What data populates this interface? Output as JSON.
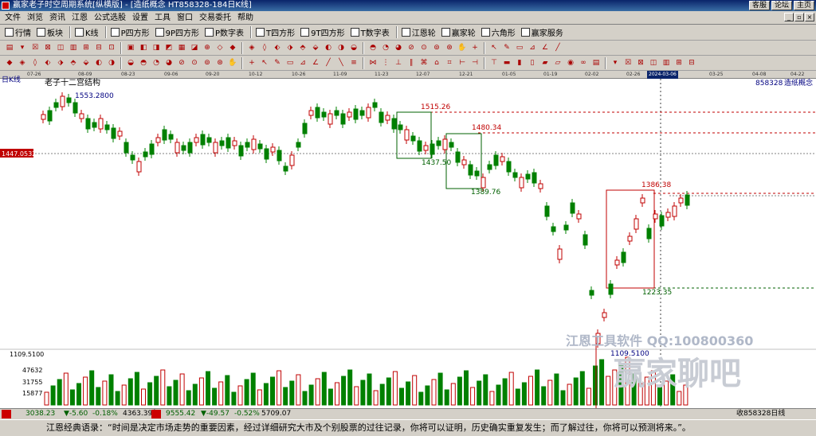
{
  "window": {
    "title": "赢家老子时空周期系统[纵横版] - [造纸概念  HT858328-184日K线]",
    "buttons": [
      "客服",
      "论坛",
      "主页"
    ]
  },
  "menu": [
    "文件",
    "浏览",
    "资讯",
    "江恩",
    "公式选股",
    "设置",
    "工具",
    "窗口",
    "交易委托",
    "帮助"
  ],
  "toolbar1": [
    "行情",
    "板块",
    "K线",
    "P四方形",
    "9P四方形",
    "P数字表",
    "T四方形",
    "9T四方形",
    "T数字表",
    "江恩轮",
    "赢家轮",
    "六角形",
    "赢家服务"
  ],
  "toolbar1_icons": [
    "table-icon",
    "grid-icon",
    "kline-icon",
    "p-square-icon",
    "9p-square-icon",
    "p-table-icon",
    "t-square-icon",
    "9t-square-icon",
    "t-table-icon",
    "gann-wheel-icon",
    "winner-wheel-icon",
    "hexagon-icon",
    "winner-service-icon"
  ],
  "date_axis": [
    "07-26",
    "08-09",
    "08-23",
    "09-06",
    "09-20",
    "10-12",
    "10-26",
    "11-09",
    "11-23",
    "12-07",
    "12-21",
    "01-05",
    "01-19",
    "02-02",
    "02-26",
    "2024-03-06",
    "03-25",
    "04-08",
    "04-22"
  ],
  "chart_header": {
    "period": "日K线",
    "structure_name": "老子十二宫结构",
    "code": "858328",
    "name": "造纸概念"
  },
  "chart_data": {
    "type": "candlestick",
    "price_labels": [
      {
        "text": "1553.2800",
        "color": "#000080"
      },
      {
        "text": "1515.26",
        "color": "#c00000"
      },
      {
        "text": "1480.34",
        "color": "#c00000"
      },
      {
        "text": "1437.50",
        "color": "#006000"
      },
      {
        "text": "1389.76",
        "color": "#006000"
      },
      {
        "text": "1386.38",
        "color": "#c00000"
      },
      {
        "text": "1223.35",
        "color": "#006000"
      },
      {
        "text": "1109.5100",
        "color": "#000080"
      }
    ],
    "crosshair_price": "1447.0532",
    "y_axis_top_label": "1109.5100",
    "volume_labels": [
      "47632",
      "31755",
      "15877"
    ],
    "watermark_1": "江恩工具软件  QQ:100800360",
    "watermark_2": "赢家聊吧"
  },
  "statusbar": {
    "sh_index": "3038.23",
    "sh_change": "▼-5.60",
    "sh_pct": "-0.18%",
    "sh_amount": "4363.39亿",
    "sz_index": "9555.42",
    "sz_change": "▼-49.57",
    "sz_pct": "-0.52%",
    "sz_amount": "5709.07",
    "right_text": "收858328日线"
  },
  "quote": "江恩经典语录：“时间是决定市场走势的重要因素，经过详细研究大市及个别股票的过往记录，你将可以证明，历史确实重复发生；而了解过往，你将可以预测将来。”。"
}
